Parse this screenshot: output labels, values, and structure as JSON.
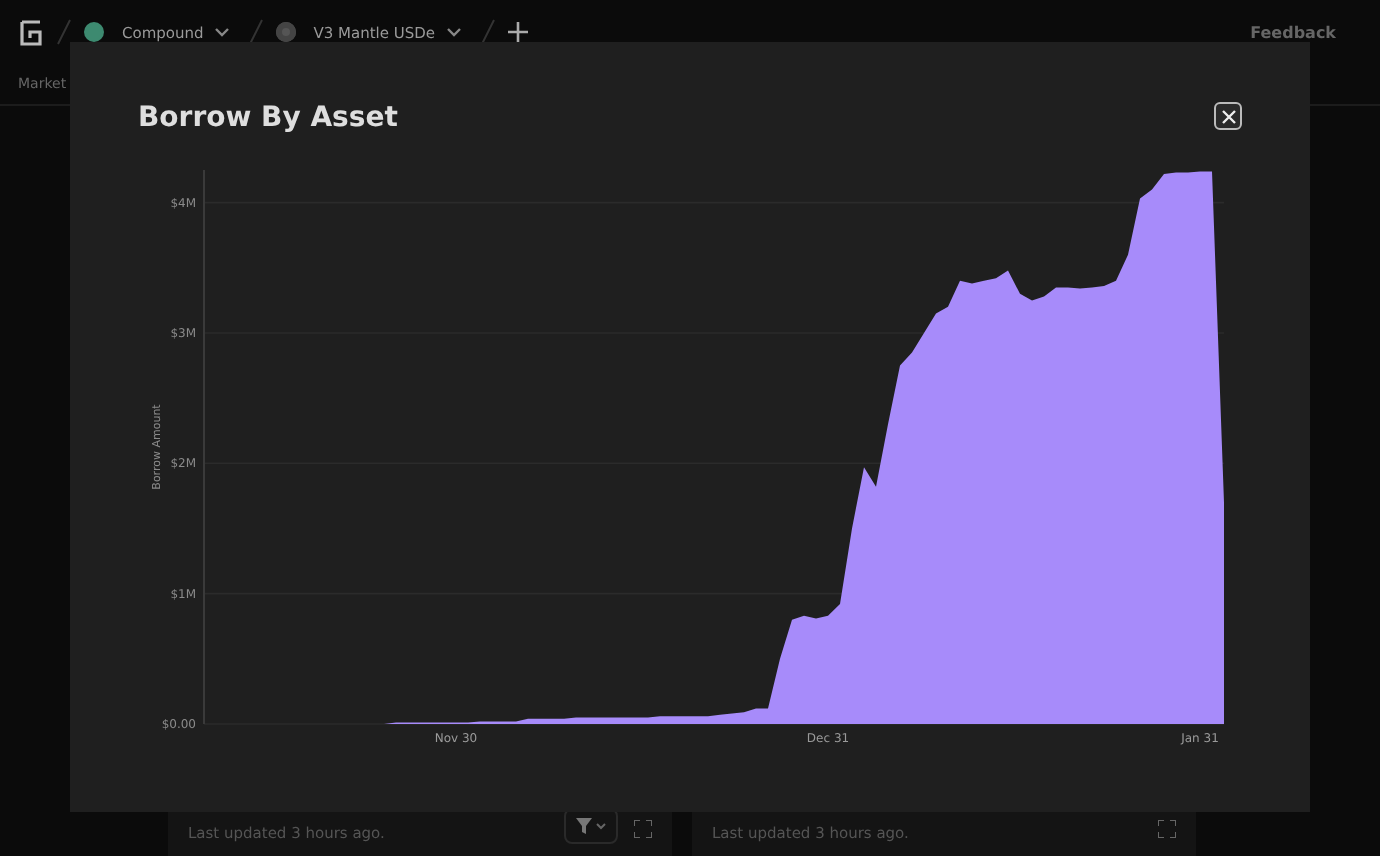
{
  "nav": {
    "items": [
      {
        "label": "Compound",
        "kind": "protocol"
      },
      {
        "label": "V3 Mantle USDe",
        "kind": "market"
      }
    ],
    "feedback": "Feedback"
  },
  "subnav": {
    "label": "Market"
  },
  "cards": [
    {
      "subtitle": "Last updated 3 hours ago.",
      "filter": true
    },
    {
      "subtitle": "Last updated 3 hours ago.",
      "filter": false
    }
  ],
  "modal": {
    "title": "Borrow By Asset",
    "chart_data": {
      "type": "area",
      "grid": true,
      "ylabel": "Borrow Amount",
      "categories": [
        null,
        null,
        null,
        null,
        null,
        null,
        null,
        null,
        null,
        null,
        null,
        null,
        null,
        null,
        null,
        null,
        null,
        null,
        null,
        null,
        null,
        "Nov 30",
        null,
        null,
        null,
        null,
        null,
        null,
        null,
        null,
        null,
        null,
        null,
        null,
        null,
        null,
        null,
        null,
        null,
        null,
        null,
        null,
        null,
        null,
        null,
        null,
        null,
        null,
        null,
        null,
        null,
        null,
        "Dec 31",
        null,
        null,
        null,
        null,
        null,
        null,
        null,
        null,
        null,
        null,
        null,
        null,
        null,
        null,
        null,
        null,
        null,
        null,
        null,
        null,
        null,
        null,
        null,
        null,
        null,
        null,
        null,
        null,
        null,
        null,
        "Jan 31",
        null,
        null
      ],
      "series": [
        {
          "color": "#a78bfa",
          "values": [
            0,
            0,
            0,
            0,
            0,
            0,
            0,
            0,
            0,
            0,
            0,
            0,
            0,
            0,
            0,
            0,
            0.01,
            0.01,
            0.01,
            0.01,
            0.01,
            0.01,
            0.01,
            0.02,
            0.02,
            0.02,
            0.02,
            0.04,
            0.04,
            0.04,
            0.04,
            0.05,
            0.05,
            0.05,
            0.05,
            0.05,
            0.05,
            0.05,
            0.06,
            0.06,
            0.06,
            0.06,
            0.06,
            0.07,
            0.08,
            0.09,
            0.12,
            0.12,
            0.5,
            0.8,
            0.83,
            0.81,
            0.83,
            0.92,
            1.5,
            1.97,
            1.82,
            2.3,
            2.75,
            2.85,
            3.0,
            3.15,
            3.2,
            3.4,
            3.38,
            3.4,
            3.42,
            3.48,
            3.3,
            3.25,
            3.28,
            3.35,
            3.35,
            3.34,
            3.35,
            3.36,
            3.4,
            3.6,
            4.03,
            4.1,
            4.22,
            4.23,
            4.23,
            4.24,
            4.24,
            1.7
          ]
        }
      ],
      "ylim": [
        0,
        4.25
      ],
      "yticks": [
        {
          "value": 0,
          "label": "$0.00"
        },
        {
          "value": 1,
          "label": "$1M"
        },
        {
          "value": 2,
          "label": "$2M"
        },
        {
          "value": 3,
          "label": "$3M"
        },
        {
          "value": 4,
          "label": "$4M"
        }
      ]
    }
  }
}
